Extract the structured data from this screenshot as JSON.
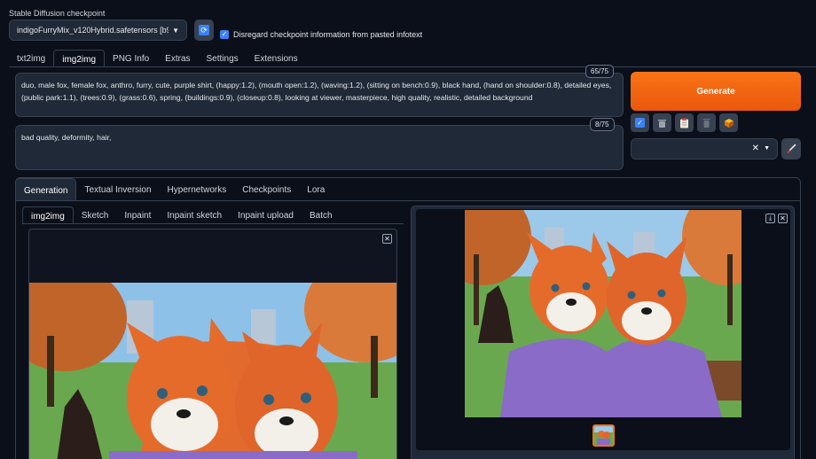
{
  "checkpoint": {
    "label": "Stable Diffusion checkpoint",
    "value": "indigoFurryMix_v120Hybrid.safetensors [b965a...",
    "disregard_label": "Disregard checkpoint information from pasted infotext"
  },
  "main_tabs": [
    {
      "label": "txt2img"
    },
    {
      "label": "img2img"
    },
    {
      "label": "PNG Info"
    },
    {
      "label": "Extras"
    },
    {
      "label": "Settings"
    },
    {
      "label": "Extensions"
    }
  ],
  "prompt": {
    "positive": "duo, male fox, female fox, anthro, furry, cute, purple shirt, (happy:1.2), (mouth open:1.2), (waving:1.2), (sitting on bench:0.9), black hand, (hand on shoulder:0.8), detailed eyes, (public park:1.1), (trees:0.9), (grass:0.6), spring, (buildings:0.9), (closeup:0.8), looking at viewer, masterpiece, high quality, realistic, detailed background",
    "positive_count": "65/75",
    "negative": "bad quality, deformity, hair,",
    "negative_count": "8/75"
  },
  "generate_label": "Generate",
  "gen_tabs": [
    {
      "label": "Generation"
    },
    {
      "label": "Textual Inversion"
    },
    {
      "label": "Hypernetworks"
    },
    {
      "label": "Checkpoints"
    },
    {
      "label": "Lora"
    }
  ],
  "sub_tabs": [
    {
      "label": "img2img"
    },
    {
      "label": "Sketch"
    },
    {
      "label": "Inpaint"
    },
    {
      "label": "Inpaint sketch"
    },
    {
      "label": "Inpaint upload"
    },
    {
      "label": "Batch"
    }
  ],
  "colors": {
    "accent": "#f97316",
    "background": "#0b0f19",
    "panel": "#1f2937",
    "check": "#3b82f6"
  }
}
